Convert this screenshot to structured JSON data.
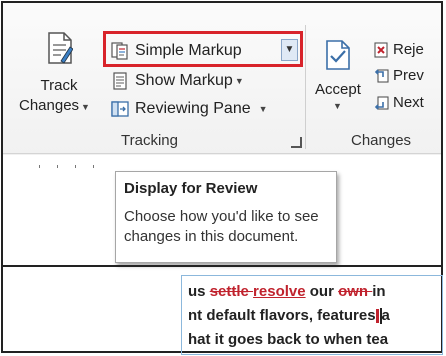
{
  "ribbon": {
    "track_changes": {
      "line1": "Track",
      "line2": "Changes"
    },
    "markup": {
      "display_value": "Simple Markup",
      "show_markup": "Show Markup",
      "reviewing_pane": "Reviewing Pane"
    },
    "accept": {
      "label": "Accept"
    },
    "changes": {
      "reject": "Reje",
      "previous": "Prev",
      "next": "Next"
    },
    "groups": {
      "tracking": "Tracking",
      "changes": "Changes"
    }
  },
  "tooltip": {
    "title": "Display for Review",
    "description": "Choose how you'd like to see changes in this document."
  },
  "document": {
    "line1": {
      "a": "us ",
      "del1": "settle ",
      "ins1": "resolve",
      "b": " our ",
      "del2": "own ",
      "c": "in"
    },
    "line2": {
      "a": "nt default flavors, features",
      "b": "a"
    },
    "line3": "hat it goes back to when tea"
  },
  "colors": {
    "highlight_box": "#d8232a",
    "revision_red": "#c0222d"
  }
}
